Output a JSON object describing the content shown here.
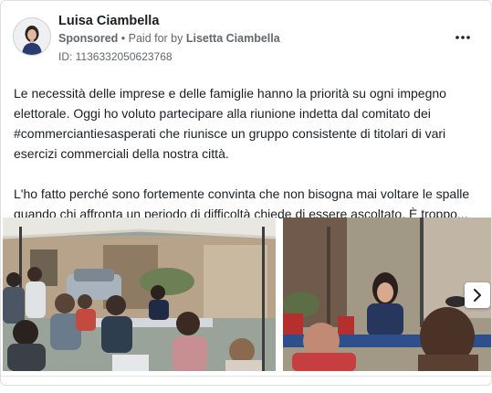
{
  "post": {
    "author": "Luisa Ciambella",
    "sponsored_label": "Sponsored",
    "separator": " • ",
    "paid_for_prefix": "Paid for by ",
    "paid_for_name": "Lisetta Ciambella",
    "ad_id": "ID: 1136332050623768",
    "paragraph_1": "Le necessità delle imprese e delle famiglie hanno la priorità su ogni impegno elettorale. Oggi ho voluto partecipare alla riunione indetta dal comitato dei #commerciantiesasperati che riunisce un gruppo consistente di titolari di vari esercizi commerciali della nostra città.",
    "paragraph_2": "L'ho fatto perché sono fortemente convinta che non bisogna mai voltare le spalle quando chi affronta un periodo di difficoltà chiede di essere ascoltato. È troppo..."
  },
  "icons": {
    "more": "more-options-icon",
    "next": "chevron-right-icon"
  },
  "colors": {
    "text_primary": "#1c1e21",
    "text_secondary": "#65676b",
    "border": "#dddfe2"
  }
}
